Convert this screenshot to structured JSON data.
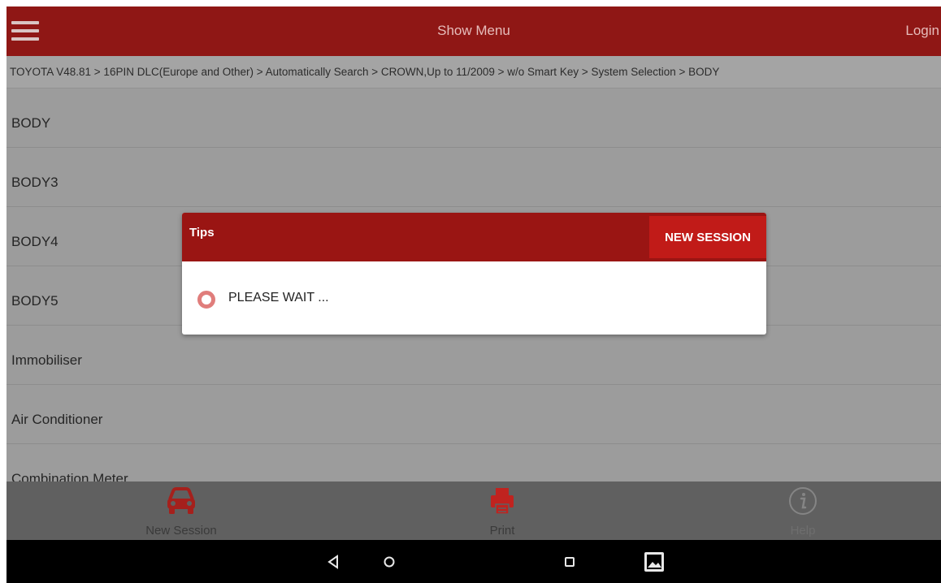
{
  "appbar": {
    "menu_icon": "hamburger-menu-icon",
    "title": "Show Menu",
    "login": "Login"
  },
  "breadcrumb": "TOYOTA V48.81 > 16PIN DLC(Europe and Other) > Automatically Search > CROWN,Up to 11/2009 > w/o Smart Key > System Selection > BODY",
  "systems": [
    "BODY",
    "BODY3",
    "BODY4",
    "BODY5",
    "Immobiliser",
    "Air Conditioner",
    "Combination Meter"
  ],
  "bottombar": {
    "new_session": {
      "label": "New Session",
      "icon": "car-icon"
    },
    "print": {
      "label": "Print",
      "icon": "printer-icon"
    },
    "help": {
      "label": "Help",
      "icon": "info-icon"
    }
  },
  "dialog": {
    "title": "Tips",
    "button": "NEW SESSION",
    "message": "PLEASE WAIT ...",
    "spinner_icon": "loading-spinner-icon"
  },
  "android_nav": [
    "back-icon",
    "home-icon",
    "recents-icon",
    "gallery-icon"
  ],
  "colors": {
    "accent": "#8f1715",
    "dialog_header": "#9a1513",
    "dialog_button": "#c11b18",
    "list_background": "#9c9c9c"
  }
}
